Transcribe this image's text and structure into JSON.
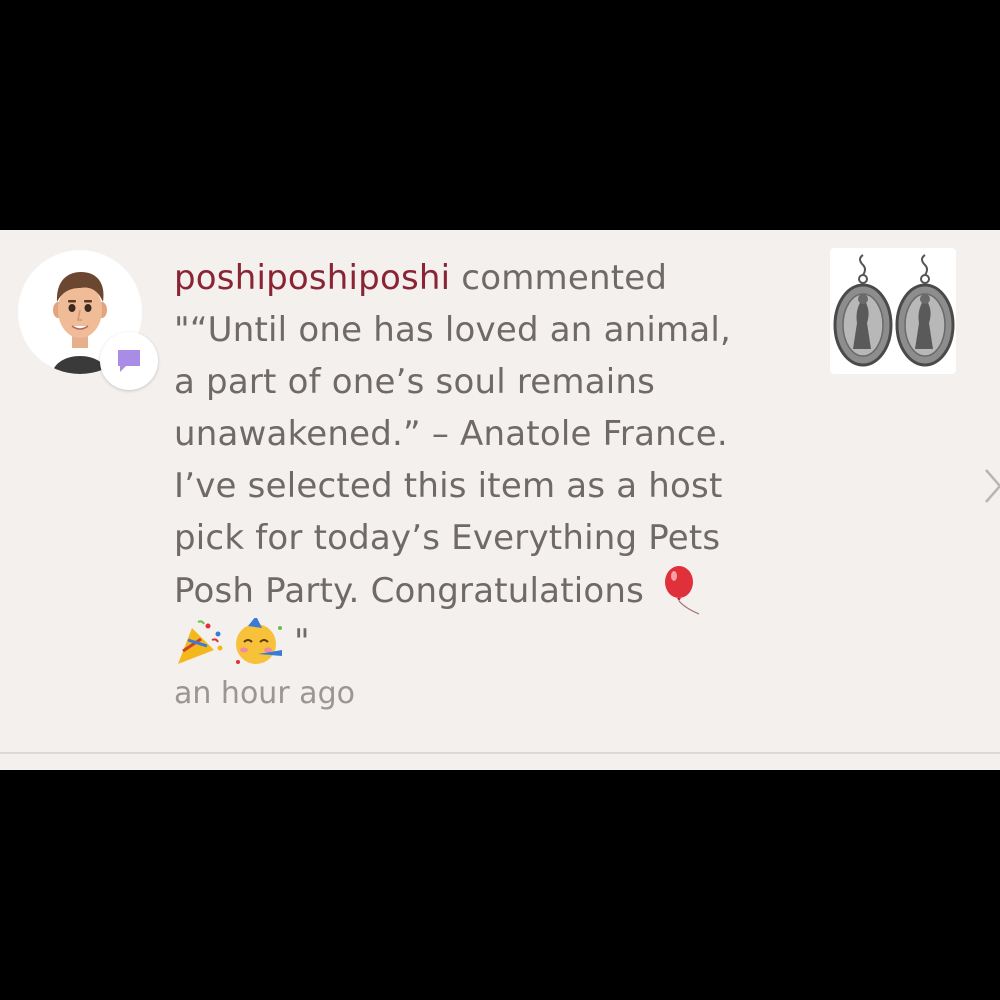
{
  "comment": {
    "username": "poshiposhiposhi",
    "action": "commented",
    "lines": [
      "\"“Until one has loved an animal,",
      "a part of one’s soul remains",
      "unawakened.” – Anatole France.",
      "I’ve selected this item as a host",
      "pick for today’s Everything Pets",
      "Posh Party. Congratulations"
    ],
    "trailing_quote": "\"",
    "timestamp": "an hour ago"
  },
  "icons": {
    "avatar": "memoji-avatar-icon",
    "badge": "comment-bubble-icon",
    "balloon": "balloon-icon",
    "party_popper": "party-popper-icon",
    "party_face": "partying-face-icon",
    "chevron": "chevron-right-icon"
  },
  "colors": {
    "background": "#000000",
    "card": "#f3f0ee",
    "username": "#8a2434",
    "body_text": "#6f6a68",
    "timestamp": "#9b9694",
    "badge_bubble": "#a98ce6"
  }
}
